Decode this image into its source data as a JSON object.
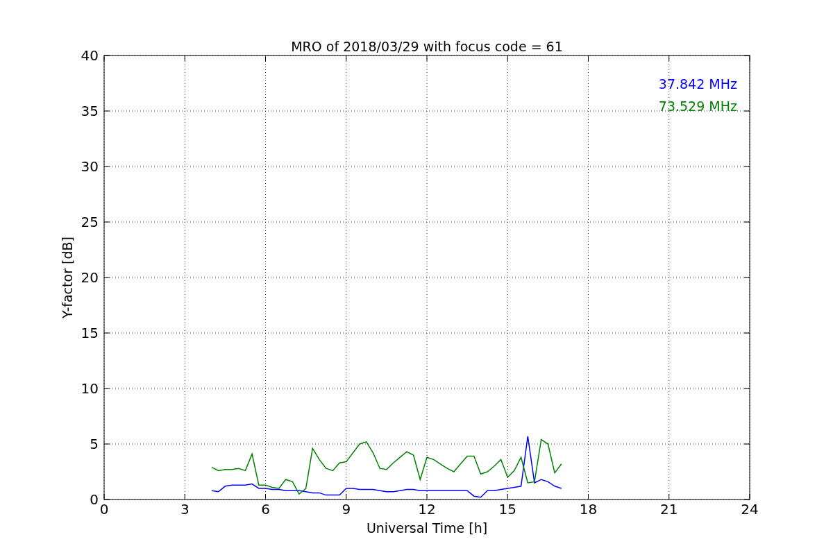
{
  "chart_data": {
    "type": "line",
    "title": "MRO of 2018/03/29 with focus code = 61",
    "xlabel": "Universal Time [h]",
    "ylabel": "Y-factor [dB]",
    "x": [
      4,
      4.25,
      4.5,
      4.75,
      5,
      5.25,
      5.5,
      5.75,
      6,
      6.25,
      6.5,
      6.75,
      7,
      7.25,
      7.5,
      7.75,
      8,
      8.25,
      8.5,
      8.75,
      9,
      9.25,
      9.5,
      9.75,
      10,
      10.25,
      10.5,
      10.75,
      11,
      11.25,
      11.5,
      11.75,
      12,
      12.25,
      12.5,
      12.75,
      13,
      13.25,
      13.5,
      13.75,
      14,
      14.25,
      14.5,
      14.75,
      15,
      15.25,
      15.5,
      15.75,
      16,
      16.25,
      16.5,
      16.75,
      17
    ],
    "series": [
      {
        "name": "37.842 MHz",
        "color": "#0000ff",
        "values": [
          0.8,
          0.7,
          1.2,
          1.3,
          1.3,
          1.3,
          1.4,
          1.0,
          1.0,
          0.9,
          0.9,
          0.8,
          0.8,
          0.8,
          0.7,
          0.6,
          0.6,
          0.4,
          0.4,
          0.4,
          1.0,
          1.0,
          0.9,
          0.9,
          0.9,
          0.8,
          0.7,
          0.7,
          0.8,
          0.9,
          0.9,
          0.8,
          0.8,
          0.8,
          0.8,
          0.8,
          0.8,
          0.8,
          0.8,
          0.3,
          0.2,
          0.8,
          0.8,
          0.9,
          1.0,
          1.1,
          1.2,
          5.7,
          1.5,
          1.8,
          1.6,
          1.2,
          1.0
        ]
      },
      {
        "name": "73.529 MHz",
        "color": "#008000",
        "values": [
          2.9,
          2.6,
          2.7,
          2.7,
          2.8,
          2.6,
          4.1,
          1.3,
          1.3,
          1.1,
          1.0,
          1.8,
          1.6,
          0.5,
          1.0,
          4.6,
          3.6,
          2.8,
          2.6,
          3.3,
          3.4,
          4.2,
          5.0,
          5.2,
          4.2,
          2.8,
          2.7,
          3.3,
          3.8,
          4.3,
          4.0,
          1.8,
          3.8,
          3.6,
          3.2,
          2.8,
          2.5,
          3.2,
          3.9,
          3.9,
          2.3,
          2.5,
          3.0,
          3.6,
          2.0,
          2.6,
          3.8,
          1.5,
          1.6,
          5.4,
          5.0,
          2.4,
          3.2
        ]
      }
    ],
    "xlim": [
      0,
      24
    ],
    "ylim": [
      0,
      40
    ],
    "xticks": [
      0,
      3,
      6,
      9,
      12,
      15,
      18,
      21,
      24
    ],
    "yticks": [
      0,
      5,
      10,
      15,
      20,
      25,
      30,
      35,
      40
    ],
    "grid": true
  }
}
